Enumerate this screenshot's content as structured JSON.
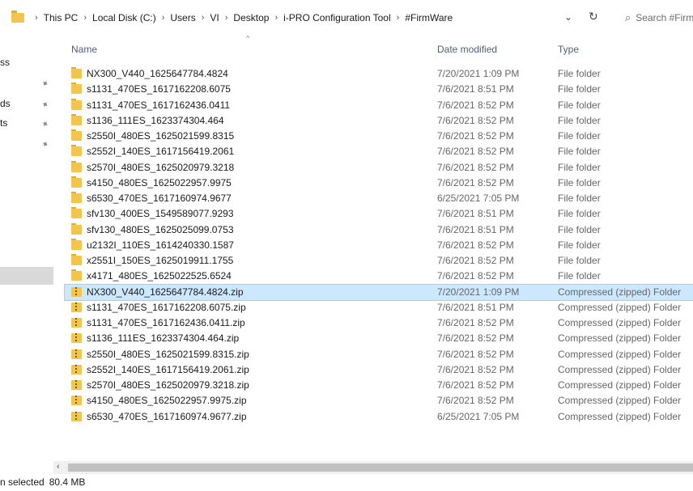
{
  "address": {
    "crumbs": [
      "This PC",
      "Local Disk (C:)",
      "Users",
      "VI",
      "Desktop",
      "i-PRO Configuration Tool",
      "#FirmWare"
    ],
    "separator": "›",
    "dropdown_glyph": "⌄",
    "refresh_glyph": "↻",
    "search_placeholder": "Search #FirmWare"
  },
  "nav": {
    "fragments": [
      "ss",
      "ds",
      "ts"
    ]
  },
  "columns": {
    "name": "Name",
    "date": "Date modified",
    "type": "Type"
  },
  "rows": [
    {
      "name": "NX300_V440_1625647784.4824",
      "date": "7/20/2021 1:09 PM",
      "type": "File folder",
      "icon": "folder-icon"
    },
    {
      "name": "s1131_470ES_1617162208.6075",
      "date": "7/6/2021 8:51 PM",
      "type": "File folder",
      "icon": "folder-icon"
    },
    {
      "name": "s1131_470ES_1617162436.0411",
      "date": "7/6/2021 8:52 PM",
      "type": "File folder",
      "icon": "folder-icon"
    },
    {
      "name": "s1136_111ES_1623374304.464",
      "date": "7/6/2021 8:52 PM",
      "type": "File folder",
      "icon": "folder-icon"
    },
    {
      "name": "s2550I_480ES_1625021599.8315",
      "date": "7/6/2021 8:52 PM",
      "type": "File folder",
      "icon": "folder-icon"
    },
    {
      "name": "s2552I_140ES_1617156419.2061",
      "date": "7/6/2021 8:52 PM",
      "type": "File folder",
      "icon": "folder-icon"
    },
    {
      "name": "s2570I_480ES_1625020979.3218",
      "date": "7/6/2021 8:52 PM",
      "type": "File folder",
      "icon": "folder-icon"
    },
    {
      "name": "s4150_480ES_1625022957.9975",
      "date": "7/6/2021 8:52 PM",
      "type": "File folder",
      "icon": "folder-icon"
    },
    {
      "name": "s6530_470ES_1617160974.9677",
      "date": "6/25/2021 7:05 PM",
      "type": "File folder",
      "icon": "folder-icon"
    },
    {
      "name": "sfv130_400ES_1549589077.9293",
      "date": "7/6/2021 8:51 PM",
      "type": "File folder",
      "icon": "folder-icon"
    },
    {
      "name": "sfv130_480ES_1625025099.0753",
      "date": "7/6/2021 8:51 PM",
      "type": "File folder",
      "icon": "folder-icon"
    },
    {
      "name": "u2132I_110ES_1614240330.1587",
      "date": "7/6/2021 8:52 PM",
      "type": "File folder",
      "icon": "folder-icon"
    },
    {
      "name": "x2551I_150ES_1625019911.1755",
      "date": "7/6/2021 8:52 PM",
      "type": "File folder",
      "icon": "folder-icon"
    },
    {
      "name": "x4171_480ES_1625022525.6524",
      "date": "7/6/2021 8:52 PM",
      "type": "File folder",
      "icon": "folder-icon"
    },
    {
      "name": "NX300_V440_1625647784.4824.zip",
      "date": "7/20/2021 1:09 PM",
      "type": "Compressed (zipped) Folder",
      "icon": "zip-folder-icon",
      "selected": true
    },
    {
      "name": "s1131_470ES_1617162208.6075.zip",
      "date": "7/6/2021 8:51 PM",
      "type": "Compressed (zipped) Folder",
      "icon": "zip-folder-icon"
    },
    {
      "name": "s1131_470ES_1617162436.0411.zip",
      "date": "7/6/2021 8:52 PM",
      "type": "Compressed (zipped) Folder",
      "icon": "zip-folder-icon"
    },
    {
      "name": "s1136_111ES_1623374304.464.zip",
      "date": "7/6/2021 8:52 PM",
      "type": "Compressed (zipped) Folder",
      "icon": "zip-folder-icon"
    },
    {
      "name": "s2550I_480ES_1625021599.8315.zip",
      "date": "7/6/2021 8:52 PM",
      "type": "Compressed (zipped) Folder",
      "icon": "zip-folder-icon"
    },
    {
      "name": "s2552I_140ES_1617156419.2061.zip",
      "date": "7/6/2021 8:52 PM",
      "type": "Compressed (zipped) Folder",
      "icon": "zip-folder-icon"
    },
    {
      "name": "s2570I_480ES_1625020979.3218.zip",
      "date": "7/6/2021 8:52 PM",
      "type": "Compressed (zipped) Folder",
      "icon": "zip-folder-icon"
    },
    {
      "name": "s4150_480ES_1625022957.9975.zip",
      "date": "7/6/2021 8:52 PM",
      "type": "Compressed (zipped) Folder",
      "icon": "zip-folder-icon"
    },
    {
      "name": "s6530_470ES_1617160974.9677.zip",
      "date": "6/25/2021 7:05 PM",
      "type": "Compressed (zipped) Folder",
      "icon": "zip-folder-icon"
    }
  ],
  "status": {
    "selection": "n selected",
    "size": "80.4 MB"
  },
  "colors": {
    "selection_bg": "#cce8ff",
    "header_text": "#4c607a",
    "folder": "#f3c54d"
  }
}
